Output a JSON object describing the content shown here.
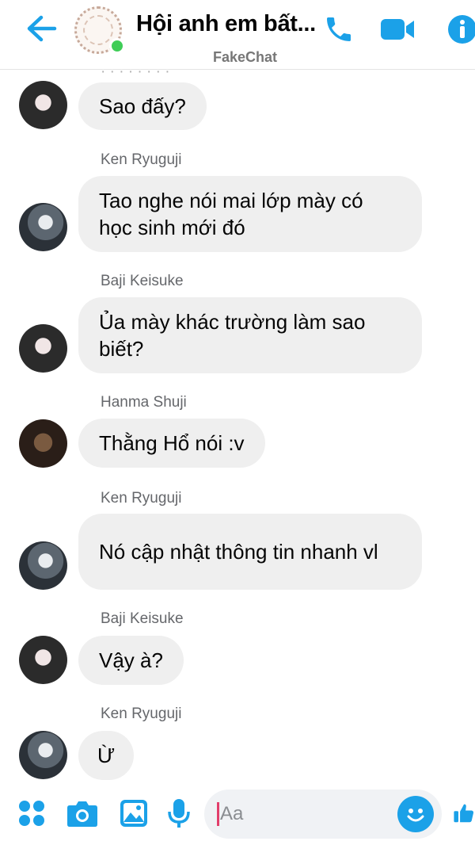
{
  "header": {
    "title": "Hội anh em bất...",
    "subtitle": "FakeChat",
    "icons": [
      "back-arrow-icon",
      "phone-icon",
      "video-camera-icon",
      "info-icon"
    ],
    "accent_color": "#1ba1e8",
    "online_color": "#3fcd57"
  },
  "messages": [
    {
      "sender": "",
      "text": "Sao đấy?",
      "avatar": "baji"
    },
    {
      "sender": "Ken Ryuguji",
      "text": "Tao nghe nói mai lớp mày có học sinh mới đó",
      "avatar": "ken"
    },
    {
      "sender": "Baji Keisuke",
      "text": "Ủa mày khác trường làm sao biết?",
      "avatar": "baji"
    },
    {
      "sender": "Hanma Shuji",
      "text": "Thằng Hổ nói :v",
      "avatar": "hanma"
    },
    {
      "sender": "Ken Ryuguji",
      "text": "Nó cập nhật thông tin nhanh vl",
      "avatar": "ken"
    },
    {
      "sender": "Baji Keisuke",
      "text": "Vậy à?",
      "avatar": "baji"
    },
    {
      "sender": "Ken Ryuguji",
      "text": "Ừ",
      "avatar": "ken"
    }
  ],
  "composer": {
    "placeholder": "Aa",
    "icons": [
      "apps-grid-icon",
      "camera-icon",
      "image-icon",
      "microphone-icon",
      "emoji-icon",
      "thumbs-up-icon"
    ]
  },
  "colors": {
    "bubble": "#efefef",
    "sender_name": "#65676b"
  }
}
